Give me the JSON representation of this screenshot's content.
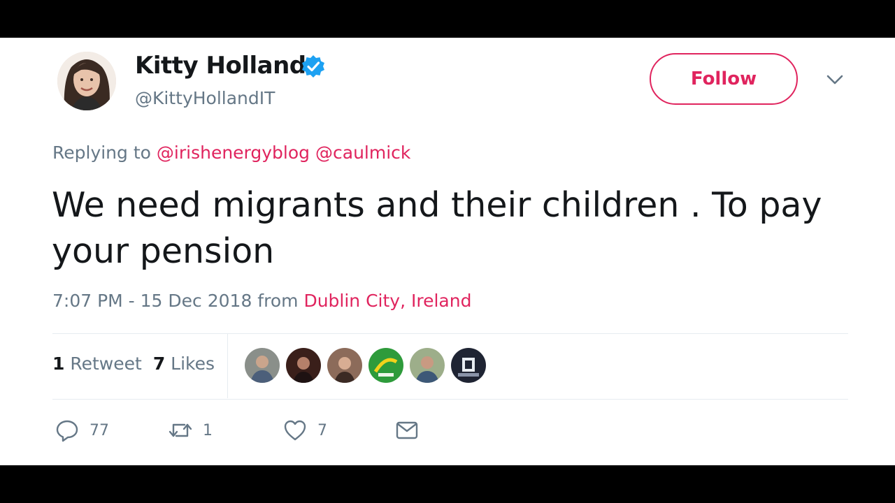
{
  "user": {
    "name": "Kitty Holland",
    "handle": "@KittyHollandIT",
    "verified": true
  },
  "follow_label": "Follow",
  "reply": {
    "prefix": "Replying to",
    "mentions": [
      "@irishenergyblog",
      "@caulmick"
    ]
  },
  "tweet": {
    "text": "We need migrants and their children . To pay your pension"
  },
  "meta": {
    "time": "7:07 PM - 15 Dec 2018 from",
    "location": "Dublin City, Ireland"
  },
  "stats": {
    "retweets_count": "1",
    "retweets_label": "Retweet",
    "likes_count": "7",
    "likes_label": "Likes"
  },
  "actions": {
    "replies": "77",
    "retweets": "1",
    "likes": "7"
  },
  "colors": {
    "accent": "#e0245e",
    "muted": "#657786",
    "text": "#14171a",
    "verified": "#1da1f2"
  },
  "icons": [
    "verified-badge-icon",
    "chevron-down-icon",
    "reply-icon",
    "retweet-icon",
    "heart-icon",
    "dm-envelope-icon"
  ]
}
